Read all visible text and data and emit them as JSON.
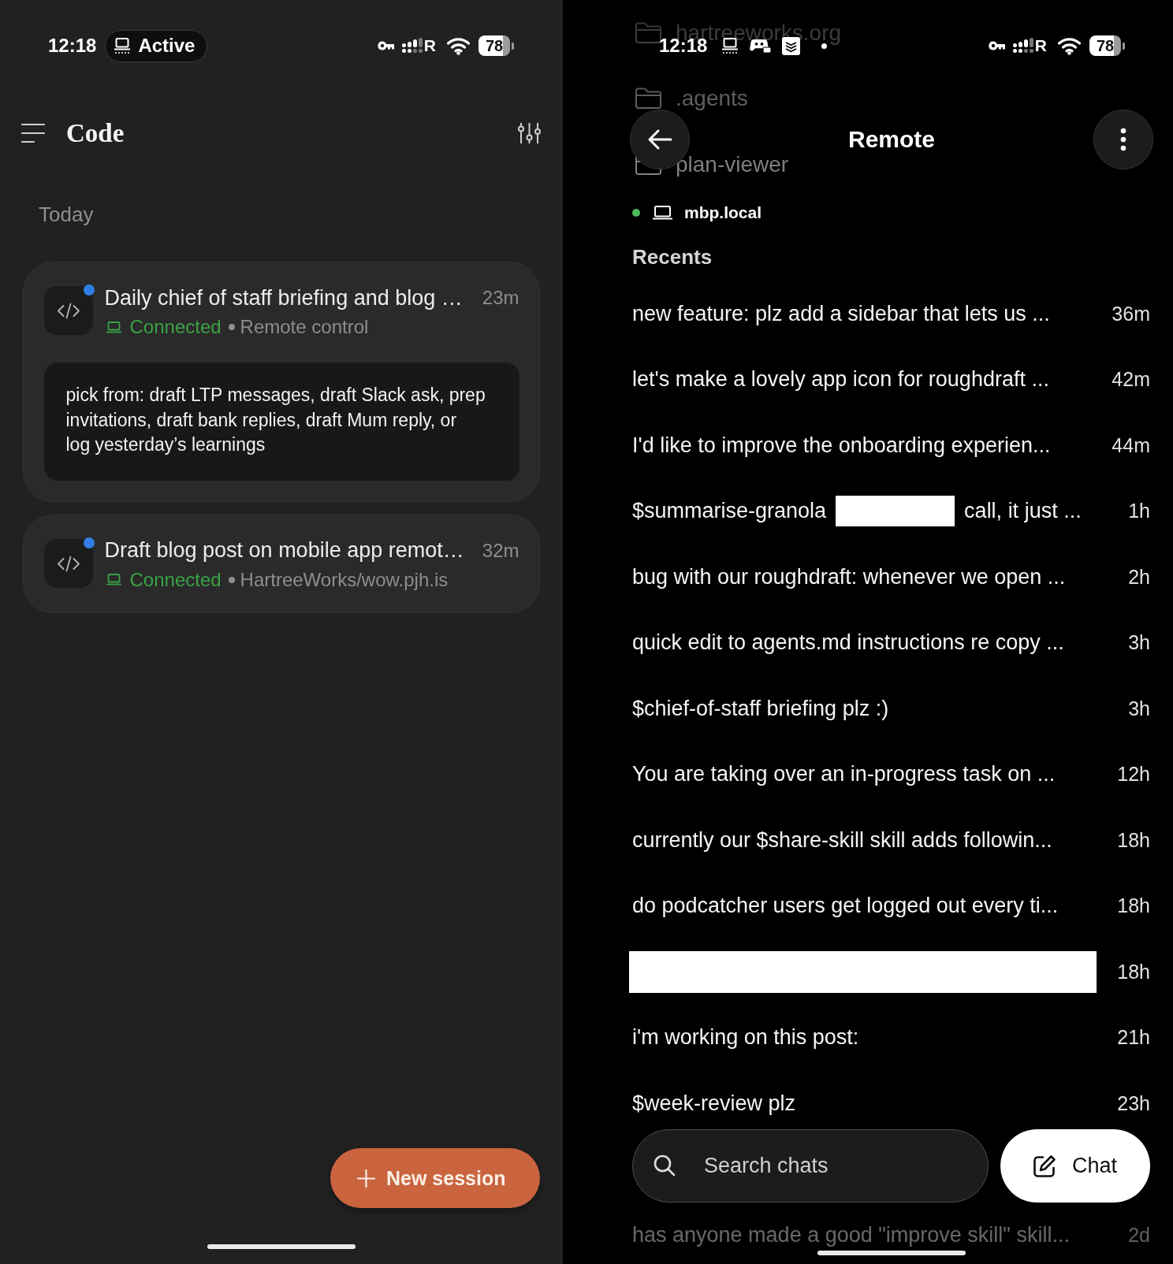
{
  "left": {
    "status_bar": {
      "time": "12:18",
      "activity_pill": "Active",
      "roaming_label": "R",
      "battery": "78"
    },
    "header": {
      "title": "Code"
    },
    "section": "Today",
    "sessions": [
      {
        "title": "Daily chief of staff briefing and blog …",
        "age": "23m",
        "unread": true,
        "connected": true,
        "status": "Connected",
        "detail": "Remote control",
        "preview": "pick from: draft LTP messages, draft Slack ask, prep\ninvitations, draft bank replies, draft Mum reply, or\nlog yesterday’s learnings"
      },
      {
        "title": "Draft blog post on mobile app remot…",
        "age": "32m",
        "unread": true,
        "connected": true,
        "status": "Connected",
        "detail": "HartreeWorks/wow.pjh.is"
      }
    ],
    "new_session_button": "New session"
  },
  "right": {
    "status_bar": {
      "time": "12:18",
      "roaming_label": "R",
      "battery": "78"
    },
    "folders": [
      {
        "name": "hartreeworks.org"
      },
      {
        "name": ".agents"
      },
      {
        "name": "plan-viewer"
      }
    ],
    "header": {
      "title": "Remote"
    },
    "machine": {
      "name": "mbp.local",
      "online": true
    },
    "section": "Recents",
    "chats": [
      {
        "segments": [
          {
            "kind": "text",
            "text": "new feature: plz add a sidebar that lets us ..."
          }
        ],
        "age": "36m"
      },
      {
        "segments": [
          {
            "kind": "text",
            "text": "let's make a lovely app icon for roughdraft ..."
          }
        ],
        "age": "42m"
      },
      {
        "segments": [
          {
            "kind": "text",
            "text": "I'd like to improve the onboarding experien..."
          }
        ],
        "age": "44m"
      },
      {
        "segments": [
          {
            "kind": "text",
            "text": "$summarise-granola"
          },
          {
            "kind": "redaction"
          },
          {
            "kind": "text",
            "text": "call, it just ..."
          }
        ],
        "age": "1h"
      },
      {
        "segments": [
          {
            "kind": "text",
            "text": "bug with our roughdraft: whenever we open ..."
          }
        ],
        "age": "2h"
      },
      {
        "segments": [
          {
            "kind": "text",
            "text": "quick edit to agents.md instructions re copy ..."
          }
        ],
        "age": "3h"
      },
      {
        "segments": [
          {
            "kind": "text",
            "text": "$chief-of-staff briefing plz :)"
          }
        ],
        "age": "3h"
      },
      {
        "segments": [
          {
            "kind": "text",
            "text": "You are taking over an in-progress task on ..."
          }
        ],
        "age": "12h"
      },
      {
        "segments": [
          {
            "kind": "text",
            "text": "currently our $share-skill skill adds followin..."
          }
        ],
        "age": "18h"
      },
      {
        "segments": [
          {
            "kind": "text",
            "text": "do podcatcher users get logged out every ti..."
          }
        ],
        "age": "18h"
      },
      {
        "segments": [
          {
            "kind": "redaction"
          }
        ],
        "age": "18h"
      },
      {
        "segments": [
          {
            "kind": "text",
            "text": "i'm working on this post:"
          }
        ],
        "age": "21h"
      },
      {
        "segments": [
          {
            "kind": "text",
            "text": "$week-review plz"
          }
        ],
        "age": "23h"
      },
      {
        "segments": [
          {
            "kind": "text",
            "text": "has anyone made a good \"improve skill\" skill..."
          }
        ],
        "age": "2d"
      }
    ],
    "search": {
      "placeholder": "Search chats"
    },
    "chat_button": "Chat"
  }
}
